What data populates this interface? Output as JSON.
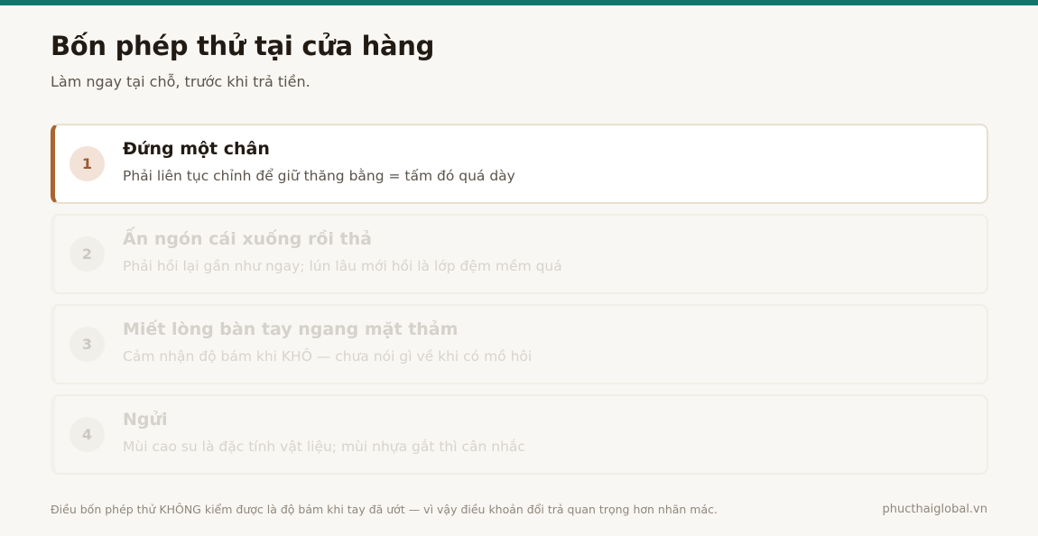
{
  "header": {
    "title": "Bốn phép thử tại cửa hàng",
    "subtitle": "Làm ngay tại chỗ, trước khi trả tiền."
  },
  "steps": [
    {
      "number": "1",
      "title": "Đứng một chân",
      "description": "Phải liên tục chỉnh để giữ thăng bằng = tấm đó quá dày",
      "active": true
    },
    {
      "number": "2",
      "title": "Ấn ngón cái xuống rồi thả",
      "description": "Phải hồi lại gần như ngay; lún lâu mới hồi là lớp đệm mềm quá",
      "active": false
    },
    {
      "number": "3",
      "title": "Miết lòng bàn tay ngang mặt thảm",
      "description": "Cảm nhận độ bám khi KHÔ — chưa nói gì về khi có mồ hôi",
      "active": false
    },
    {
      "number": "4",
      "title": "Ngửi",
      "description": "Mùi cao su là đặc tính vật liệu; mùi nhựa gắt thì cân nhắc",
      "active": false
    }
  ],
  "footer": {
    "note": "Điều bốn phép thử KHÔNG kiểm được là độ bám khi tay đã ướt — vì vậy điều khoản đổi trả quan trọng hơn nhãn mác.",
    "site": "phucthaiglobal.vn"
  },
  "colors": {
    "top_bar": "#11756a",
    "accent": "#a96430",
    "background": "#f9f7f3"
  }
}
